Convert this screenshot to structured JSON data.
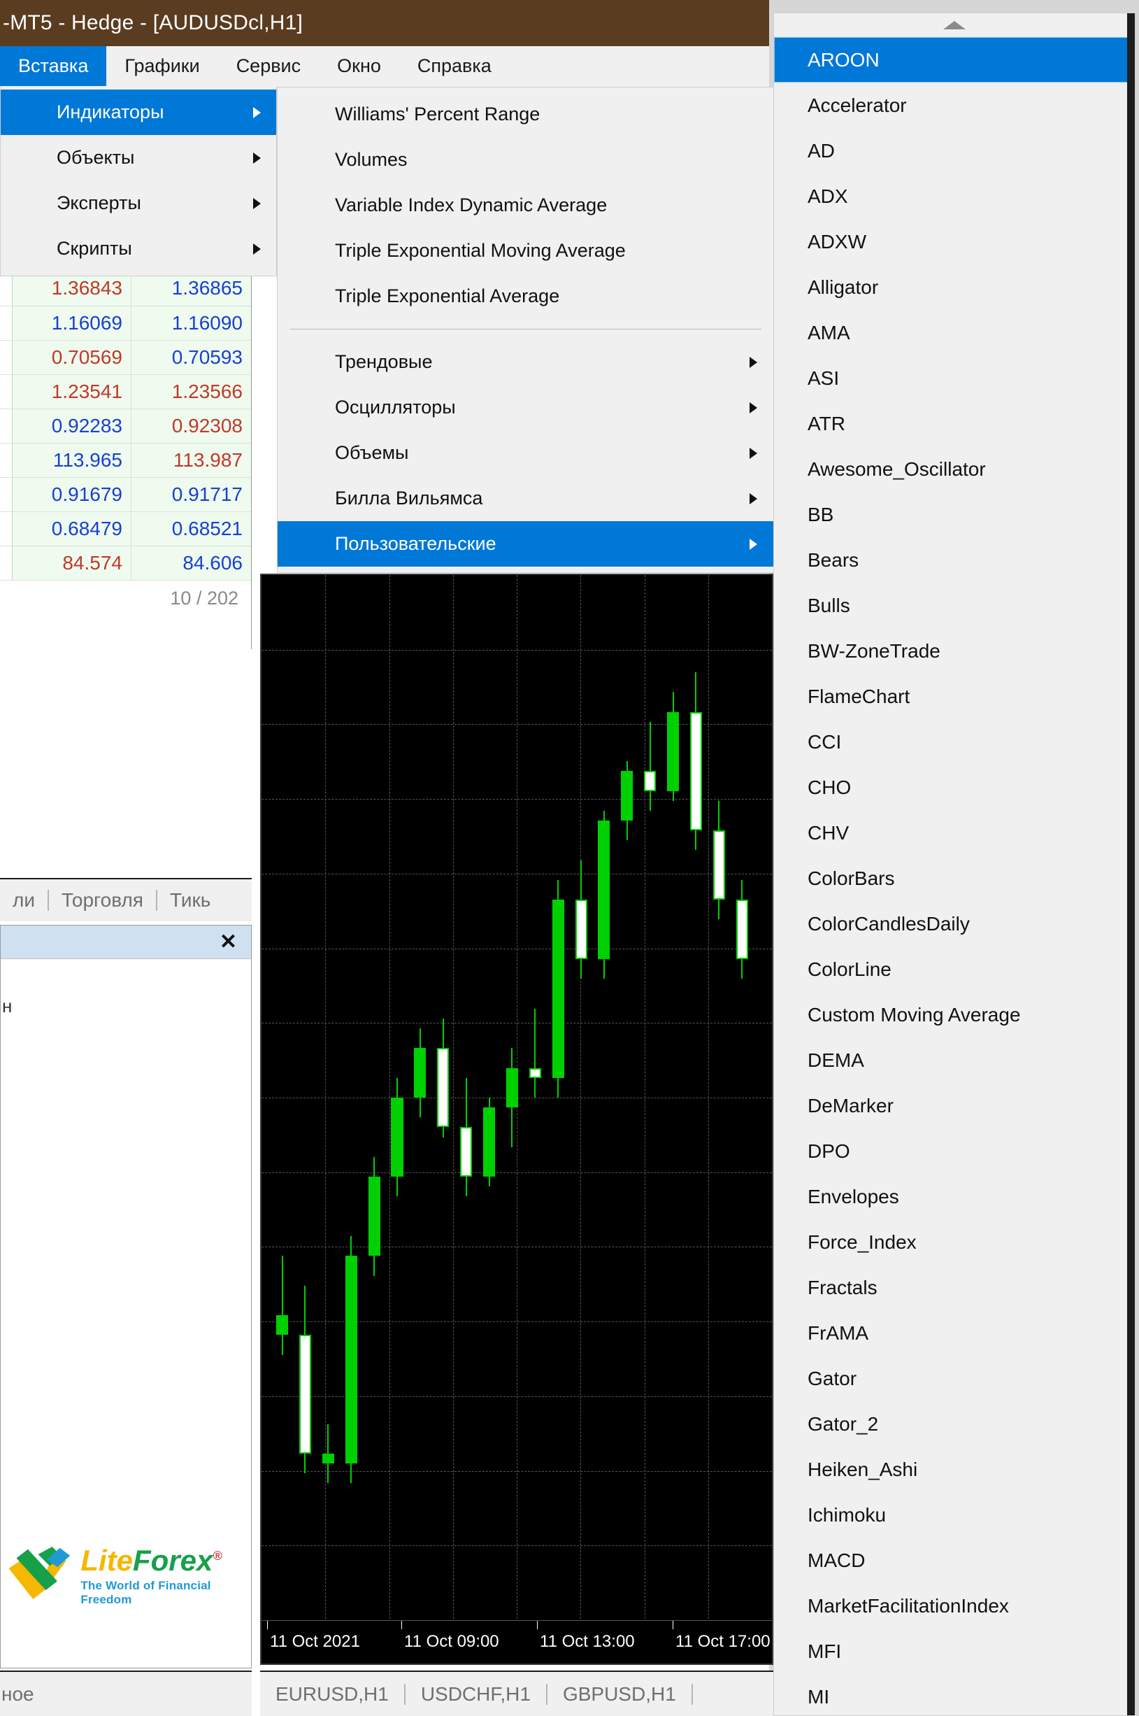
{
  "window": {
    "title": "-MT5 - Hedge - [AUDUSDcl,H1]"
  },
  "menubar": {
    "items": [
      {
        "label": "Вставка",
        "active": true
      },
      {
        "label": "Графики",
        "active": false
      },
      {
        "label": "Сервис",
        "active": false
      },
      {
        "label": "Окно",
        "active": false
      },
      {
        "label": "Справка",
        "active": false
      }
    ]
  },
  "insert_menu": {
    "items": [
      {
        "label": "Индикаторы",
        "submenu": true,
        "selected": true
      },
      {
        "label": "Объекты",
        "submenu": true,
        "selected": false
      },
      {
        "label": "Эксперты",
        "submenu": true,
        "selected": false
      },
      {
        "label": "Скрипты",
        "submenu": true,
        "selected": false
      }
    ]
  },
  "indicators_menu": {
    "items": [
      {
        "label": "Williams' Percent Range",
        "submenu": false,
        "selected": false
      },
      {
        "label": "Volumes",
        "submenu": false,
        "selected": false
      },
      {
        "label": "Variable Index Dynamic Average",
        "submenu": false,
        "selected": false
      },
      {
        "label": "Triple Exponential Moving Average",
        "submenu": false,
        "selected": false
      },
      {
        "label": "Triple Exponential Average",
        "submenu": false,
        "selected": false
      },
      {
        "separator": true
      },
      {
        "label": "Трендовые",
        "submenu": true,
        "selected": false
      },
      {
        "label": "Осцилляторы",
        "submenu": true,
        "selected": false
      },
      {
        "label": "Объемы",
        "submenu": true,
        "selected": false
      },
      {
        "label": "Билла Вильямса",
        "submenu": true,
        "selected": false
      },
      {
        "label": "Пользовательские",
        "submenu": true,
        "selected": true
      }
    ]
  },
  "custom_indicators_menu": {
    "scroll_up_icon": "triangle-up-icon",
    "items": [
      {
        "label": "AROON",
        "selected": true
      },
      {
        "label": "Accelerator",
        "selected": false
      },
      {
        "label": "AD",
        "selected": false
      },
      {
        "label": "ADX",
        "selected": false
      },
      {
        "label": "ADXW",
        "selected": false
      },
      {
        "label": "Alligator",
        "selected": false
      },
      {
        "label": "AMA",
        "selected": false
      },
      {
        "label": "ASI",
        "selected": false
      },
      {
        "label": "ATR",
        "selected": false
      },
      {
        "label": "Awesome_Oscillator",
        "selected": false
      },
      {
        "label": "BB",
        "selected": false
      },
      {
        "label": "Bears",
        "selected": false
      },
      {
        "label": "Bulls",
        "selected": false
      },
      {
        "label": "BW-ZoneTrade",
        "selected": false
      },
      {
        "label": "FlameChart",
        "selected": false
      },
      {
        "label": "CCI",
        "selected": false
      },
      {
        "label": "CHO",
        "selected": false
      },
      {
        "label": "CHV",
        "selected": false
      },
      {
        "label": "ColorBars",
        "selected": false
      },
      {
        "label": "ColorCandlesDaily",
        "selected": false
      },
      {
        "label": "ColorLine",
        "selected": false
      },
      {
        "label": "Custom Moving Average",
        "selected": false
      },
      {
        "label": "DEMA",
        "selected": false
      },
      {
        "label": "DeMarker",
        "selected": false
      },
      {
        "label": "DPO",
        "selected": false
      },
      {
        "label": "Envelopes",
        "selected": false
      },
      {
        "label": "Force_Index",
        "selected": false
      },
      {
        "label": "Fractals",
        "selected": false
      },
      {
        "label": "FrAMA",
        "selected": false
      },
      {
        "label": "Gator",
        "selected": false
      },
      {
        "label": "Gator_2",
        "selected": false
      },
      {
        "label": "Heiken_Ashi",
        "selected": false
      },
      {
        "label": "Ichimoku",
        "selected": false
      },
      {
        "label": "MACD",
        "selected": false
      },
      {
        "label": "MarketFacilitationIndex",
        "selected": false
      },
      {
        "label": "MFI",
        "selected": false
      },
      {
        "label": "MI",
        "selected": false
      }
    ]
  },
  "market_watch": {
    "rows": [
      {
        "bid": "1.36843",
        "bid_dir": "down",
        "ask": "1.36865",
        "ask_dir": "up"
      },
      {
        "bid": "1.16069",
        "bid_dir": "up",
        "ask": "1.16090",
        "ask_dir": "up"
      },
      {
        "bid": "0.70569",
        "bid_dir": "down",
        "ask": "0.70593",
        "ask_dir": "up"
      },
      {
        "bid": "1.23541",
        "bid_dir": "down",
        "ask": "1.23566",
        "ask_dir": "down"
      },
      {
        "bid": "0.92283",
        "bid_dir": "up",
        "ask": "0.92308",
        "ask_dir": "down"
      },
      {
        "bid": "113.965",
        "bid_dir": "up",
        "ask": "113.987",
        "ask_dir": "down"
      },
      {
        "bid": "0.91679",
        "bid_dir": "up",
        "ask": "0.91717",
        "ask_dir": "up"
      },
      {
        "bid": "0.68479",
        "bid_dir": "up",
        "ask": "0.68521",
        "ask_dir": "up"
      },
      {
        "bid": "84.574",
        "bid_dir": "down",
        "ask": "84.606",
        "ask_dir": "up"
      }
    ],
    "counter": "10 / 202"
  },
  "left_tabs": {
    "items": [
      "ли",
      "Торговля",
      "Тикь"
    ]
  },
  "subwindow": {
    "close_icon": "close-icon",
    "stub_text": "н"
  },
  "logo": {
    "lite": "Lite",
    "forex": "Forex",
    "registered": "®",
    "tagline": "The World of Financial Freedom"
  },
  "status_left": {
    "text": "ное"
  },
  "chart_tabs": {
    "items": [
      "EURUSD,H1",
      "USDCHF,H1",
      "GBPUSD,H1"
    ]
  },
  "chart_data": {
    "type": "candlestick",
    "title": "AUDUSDcl,H1",
    "xlabel": "",
    "ylabel": "",
    "grid": true,
    "background": "#000000",
    "bull_color": "#ffffff",
    "bear_color": "#00d000",
    "outline_color": "#00d000",
    "time_labels": [
      "11 Oct 2021",
      "11 Oct 09:00",
      "11 Oct 13:00",
      "11 Oct 17:00"
    ],
    "time_label_x": [
      8,
      200,
      394,
      588
    ],
    "candles": [
      {
        "open": 28,
        "high": 34,
        "low": 24,
        "close": 26,
        "dir": "bear"
      },
      {
        "open": 26,
        "high": 31,
        "low": 12,
        "close": 14,
        "dir": "bull"
      },
      {
        "open": 14,
        "high": 17,
        "low": 11,
        "close": 13,
        "dir": "bear"
      },
      {
        "open": 13,
        "high": 36,
        "low": 11,
        "close": 34,
        "dir": "bear"
      },
      {
        "open": 34,
        "high": 44,
        "low": 32,
        "close": 42,
        "dir": "bear"
      },
      {
        "open": 42,
        "high": 52,
        "low": 40,
        "close": 50,
        "dir": "bear"
      },
      {
        "open": 50,
        "high": 57,
        "low": 48,
        "close": 55,
        "dir": "bear"
      },
      {
        "open": 55,
        "high": 58,
        "low": 46,
        "close": 47,
        "dir": "bull"
      },
      {
        "open": 47,
        "high": 52,
        "low": 40,
        "close": 42,
        "dir": "bull"
      },
      {
        "open": 42,
        "high": 50,
        "low": 41,
        "close": 49,
        "dir": "bear"
      },
      {
        "open": 49,
        "high": 55,
        "low": 45,
        "close": 53,
        "dir": "bear"
      },
      {
        "open": 53,
        "high": 59,
        "low": 50,
        "close": 52,
        "dir": "bull"
      },
      {
        "open": 52,
        "high": 72,
        "low": 50,
        "close": 70,
        "dir": "bear"
      },
      {
        "open": 70,
        "high": 74,
        "low": 62,
        "close": 64,
        "dir": "bull"
      },
      {
        "open": 64,
        "high": 79,
        "low": 62,
        "close": 78,
        "dir": "bear"
      },
      {
        "open": 78,
        "high": 84,
        "low": 76,
        "close": 83,
        "dir": "bear"
      },
      {
        "open": 83,
        "high": 88,
        "low": 79,
        "close": 81,
        "dir": "bull"
      },
      {
        "open": 81,
        "high": 91,
        "low": 80,
        "close": 89,
        "dir": "bear"
      },
      {
        "open": 89,
        "high": 93,
        "low": 75,
        "close": 77,
        "dir": "bull"
      },
      {
        "open": 77,
        "high": 80,
        "low": 68,
        "close": 70,
        "dir": "bull"
      },
      {
        "open": 70,
        "high": 72,
        "low": 62,
        "close": 64,
        "dir": "bull"
      }
    ]
  }
}
